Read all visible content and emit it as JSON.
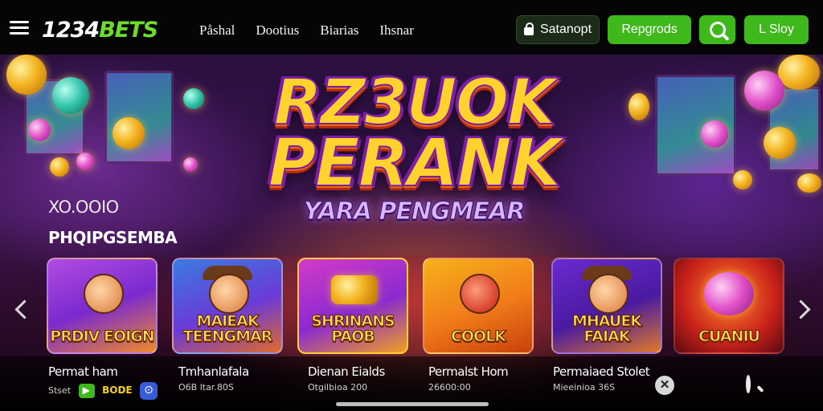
{
  "brand": {
    "number": "1234",
    "name": "BETS"
  },
  "nav": {
    "links": [
      "Påshal",
      "Dootius",
      "Biarias",
      "Ihsnar"
    ]
  },
  "buttons": {
    "dark_label": "Satanopt",
    "register_label": "Repgrods",
    "login_label": "L Sloy"
  },
  "hero": {
    "line1": "RZ3UOK",
    "line2": "PERANK",
    "subline": "YARA PENGMEAR",
    "side_top": "XO.OOIO",
    "side_bottom": "PHQIPGSEMBA"
  },
  "games": [
    {
      "title": "PRDIV EOIGN",
      "name": "Permat ham",
      "meta": "Stset",
      "badge": "BODE"
    },
    {
      "title": "MAIEAK TEENGMAR",
      "name": "Tmhanlafala",
      "meta": "O6B ltar.80S"
    },
    {
      "title": "SHRINANS PAOB",
      "name": "Dienan Eialds",
      "meta": "Otgilbioa 200"
    },
    {
      "title": "COOLK",
      "name": "Permalst Hom",
      "meta": "26600:00"
    },
    {
      "title": "MHAUEK FAIAK",
      "name": "Permaiaed Stolet",
      "meta": "Mieeinioa 36S"
    },
    {
      "title": "CUANIU",
      "name": "",
      "meta": ""
    }
  ],
  "colors": {
    "accent_green": "#3fb81c",
    "logo_green": "#6fdc2a",
    "title_gold": "#ffd22e"
  },
  "icons": [
    "hamburger-icon",
    "lock-icon",
    "search-icon",
    "chevron-left-icon",
    "chevron-right-icon",
    "close-icon"
  ]
}
